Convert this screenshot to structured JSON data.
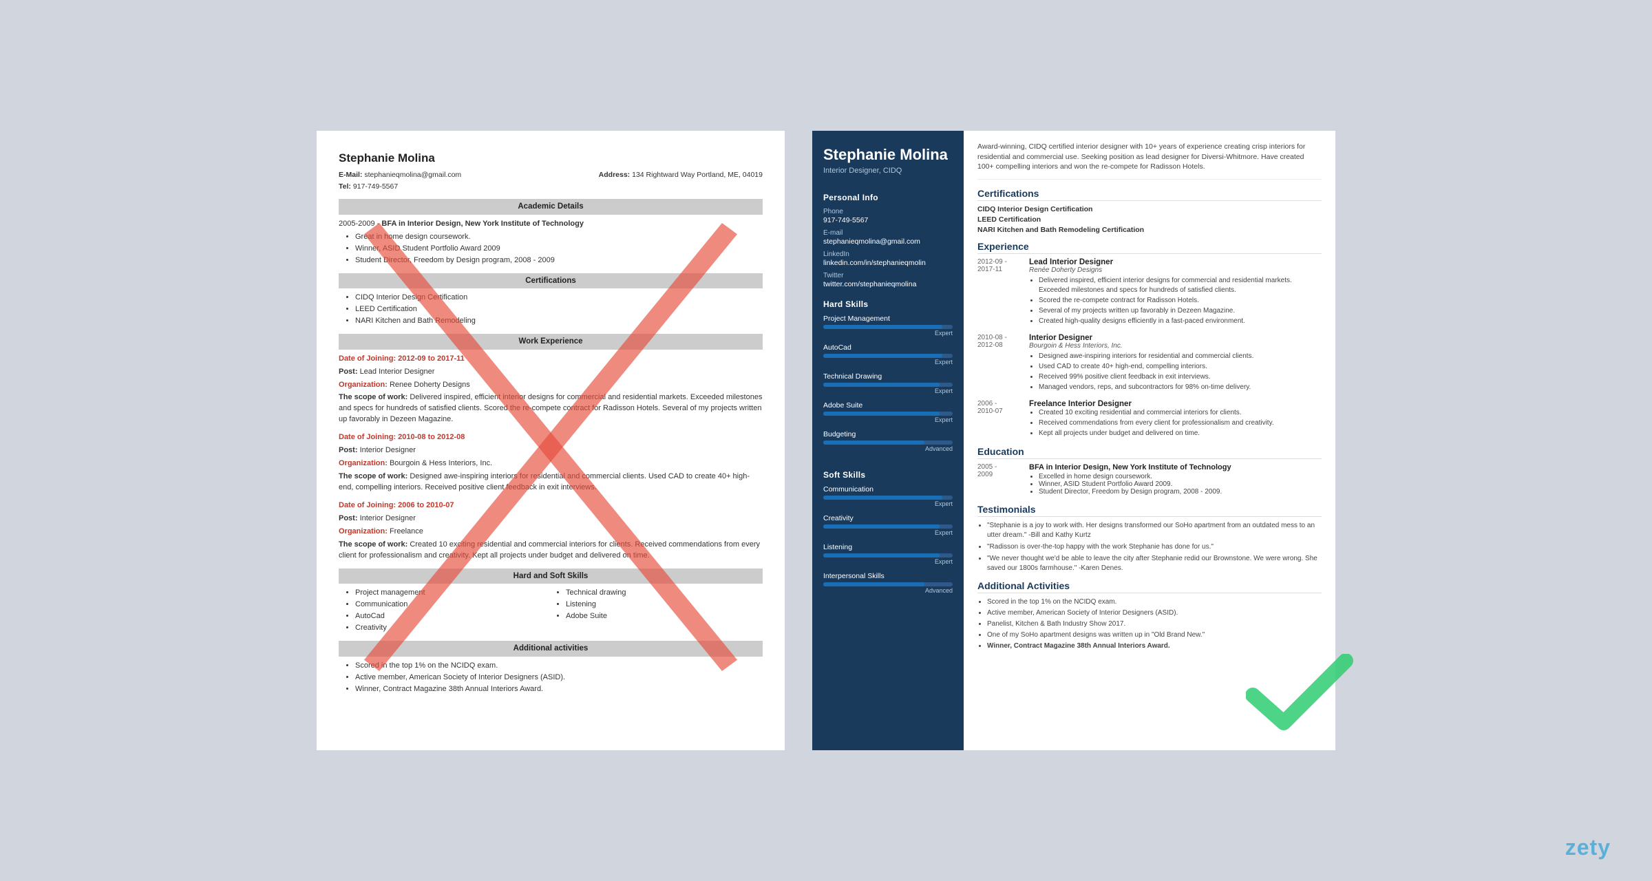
{
  "watermark": "zety",
  "left_resume": {
    "name": "Stephanie Molina",
    "email_label": "E-Mail:",
    "email": "stephanieqmolina@gmail.com",
    "address_label": "Address:",
    "address": "134 Rightward Way Portland, ME, 04019",
    "tel_label": "Tel:",
    "tel": "917-749-5567",
    "sections": {
      "academic": {
        "title": "Academic Details",
        "entry": {
          "dates": "2005-2009 -",
          "degree": "BFA in Interior Design, New York Institute of Technology",
          "bullets": [
            "Great in home design coursework.",
            "Winner, ASID Student Portfolio Award 2009",
            "Student Director, Freedom by Design program, 2008 - 2009"
          ]
        }
      },
      "certifications": {
        "title": "Certifications",
        "items": [
          "CIDQ Interior Design Certification",
          "LEED Certification",
          "NARI Kitchen and Bath Remodeling"
        ]
      },
      "work_experience": {
        "title": "Work Experience",
        "entries": [
          {
            "dates": "Date of Joining: 2012-09 to 2017-11",
            "post_label": "Post:",
            "post": "Lead Interior Designer",
            "org_label": "Organization:",
            "org": "Renee Doherty Designs",
            "scope_label": "The scope of work:",
            "scope": "Delivered inspired, efficient interior designs for commercial and residential markets. Exceeded milestones and specs for hundreds of satisfied clients. Scored the re-compete contract for Radisson Hotels. Several of my projects written up favorably in Dezeen Magazine."
          },
          {
            "dates": "Date of Joining: 2010-08 to 2012-08",
            "post_label": "Post:",
            "post": "Interior Designer",
            "org_label": "Organization:",
            "org": "Bourgoin & Hess Interiors, Inc.",
            "scope_label": "The scope of work:",
            "scope": "Designed awe-inspiring interiors for residential and commercial clients. Used CAD to create 40+ high-end, compelling interiors. Received positive client feedback in exit interviews."
          },
          {
            "dates": "Date of Joining: 2006 to 2010-07",
            "post_label": "Post:",
            "post": "Interior Designer",
            "org_label": "Organization:",
            "org": "Freelance",
            "scope_label": "The scope of work:",
            "scope": "Created 10 exciting residential and commercial interiors for clients. Received commendations from every client for professionalism and creativity. Kept all projects under budget and delivered on time."
          }
        ]
      },
      "skills": {
        "title": "Hard and Soft Skills",
        "items": [
          "Project management",
          "Communication",
          "AutoCad",
          "Creativity",
          "Technical drawing",
          "Listening",
          "Adobe Suite"
        ]
      },
      "additional": {
        "title": "Additional activities",
        "items": [
          "Scored in the top 1% on the NCIDQ exam.",
          "Active member, American Society of Interior Designers (ASID).",
          "Winner, Contract Magazine 38th Annual Interiors Award."
        ]
      }
    }
  },
  "right_resume": {
    "name": "Stephanie Molina",
    "title": "Interior Designer, CIDQ",
    "objective": "Award-winning, CIDQ certified interior designer with 10+ years of experience creating crisp interiors for residential and commercial use. Seeking position as lead designer for Diversi-Whitmore. Have created 100+ compelling interiors and won the re-compete for Radisson Hotels.",
    "personal_info": {
      "section_title": "Personal Info",
      "phone_label": "Phone",
      "phone": "917-749-5567",
      "email_label": "E-mail",
      "email": "stephanieqmolina@gmail.com",
      "linkedin_label": "LinkedIn",
      "linkedin": "linkedin.com/in/stephanieqmolin",
      "twitter_label": "Twitter",
      "twitter": "twitter.com/stephanieqmolina"
    },
    "hard_skills": {
      "section_title": "Hard Skills",
      "items": [
        {
          "name": "Project Management",
          "level": "Expert",
          "pct": 92
        },
        {
          "name": "AutoCad",
          "level": "Expert",
          "pct": 92
        },
        {
          "name": "Technical Drawing",
          "level": "Expert",
          "pct": 90
        },
        {
          "name": "Adobe Suite",
          "level": "Expert",
          "pct": 90
        },
        {
          "name": "Budgeting",
          "level": "Advanced",
          "pct": 78
        }
      ]
    },
    "soft_skills": {
      "section_title": "Soft Skills",
      "items": [
        {
          "name": "Communication",
          "level": "Expert",
          "pct": 92
        },
        {
          "name": "Creativity",
          "level": "Expert",
          "pct": 90
        },
        {
          "name": "Listening",
          "level": "Expert",
          "pct": 90
        },
        {
          "name": "Interpersonal Skills",
          "level": "Advanced",
          "pct": 78
        }
      ]
    },
    "certifications": {
      "section_title": "Certifications",
      "items": [
        "CIDQ Interior Design Certification",
        "LEED Certification",
        "NARI Kitchen and Bath Remodeling Certification"
      ]
    },
    "experience": {
      "section_title": "Experience",
      "entries": [
        {
          "dates": "2012-09 -\n2017-11",
          "title": "Lead Interior Designer",
          "company": "Renée Doherty Designs",
          "bullets": [
            "Delivered inspired, efficient interior designs for commercial and residential markets. Exceeded milestones and specs for hundreds of satisfied clients.",
            "Scored the re-compete contract for Radisson Hotels.",
            "Several of my projects written up favorably in Dezeen Magazine.",
            "Created high-quality designs efficiently in a fast-paced environment."
          ]
        },
        {
          "dates": "2010-08 -\n2012-08",
          "title": "Interior Designer",
          "company": "Bourgoin & Hess Interiors, Inc.",
          "bullets": [
            "Designed awe-inspiring interiors for residential and commercial clients.",
            "Used CAD to create 40+ high-end, compelling interiors.",
            "Received 99% positive client feedback in exit interviews.",
            "Managed vendors, reps, and subcontractors for 98% on-time delivery."
          ]
        },
        {
          "dates": "2006 -\n2010-07",
          "title": "Freelance Interior Designer",
          "company": "",
          "bullets": [
            "Created 10 exciting residential and commercial interiors for clients.",
            "Received commendations from every client for professionalism and creativity.",
            "Kept all projects under budget and delivered on time."
          ]
        }
      ]
    },
    "education": {
      "section_title": "Education",
      "entries": [
        {
          "dates": "2005 -\n2009",
          "title": "BFA in Interior Design, New York Institute of Technology",
          "bullets": [
            "Excelled in home design coursework.",
            "Winner, ASID Student Portfolio Award 2009.",
            "Student Director, Freedom by Design program, 2008 - 2009."
          ]
        }
      ]
    },
    "testimonials": {
      "section_title": "Testimonials",
      "items": [
        "\"Stephanie is a joy to work with. Her designs transformed our SoHo apartment from an outdated mess to an utter dream.\" -Bill and Kathy Kurtz",
        "\"Radisson is over-the-top happy with the work Stephanie has done for us.\"",
        "\"We never thought we'd be able to leave the city after Stephanie redid our Brownstone. We were wrong. She saved our 1800s farmhouse.\" -Karen Denes."
      ]
    },
    "additional": {
      "section_title": "Additional Activities",
      "items": [
        "Scored in the top 1% on the NCIDQ exam.",
        "Active member, American Society of Interior Designers (ASID).",
        "Panelist, Kitchen & Bath Industry Show 2017.",
        "One of my SoHo apartment designs was written up in \"Old Brand New.\"",
        "Winner, Contract Magazine 38th Annual Interiors Award."
      ]
    }
  }
}
